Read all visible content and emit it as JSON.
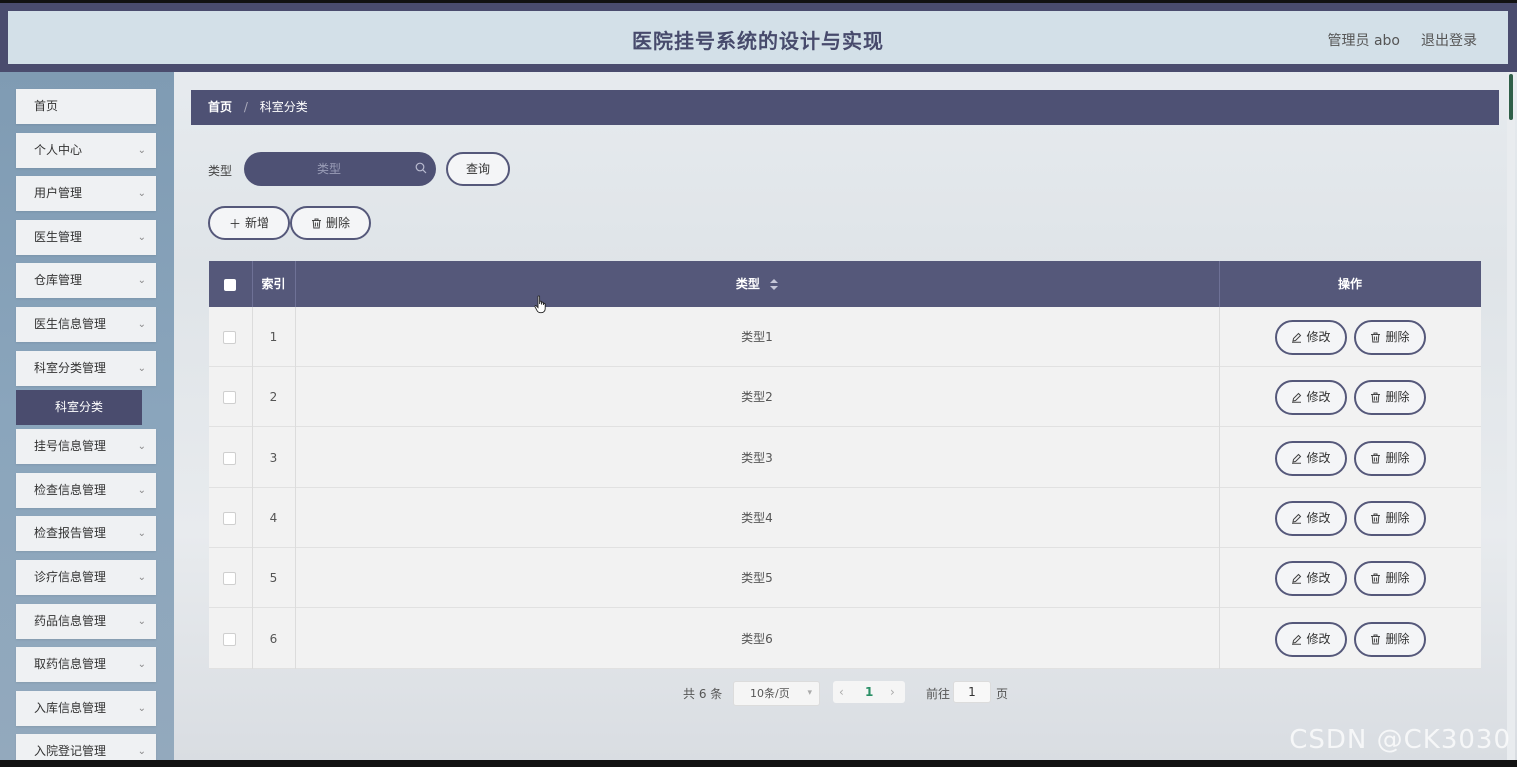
{
  "header": {
    "title": "医院挂号系统的设计与实现",
    "user": "管理员 abo",
    "logout": "退出登录"
  },
  "sidebar": {
    "items": [
      {
        "label": "首页",
        "has_children": false
      },
      {
        "label": "个人中心",
        "has_children": true
      },
      {
        "label": "用户管理",
        "has_children": true
      },
      {
        "label": "医生管理",
        "has_children": true
      },
      {
        "label": "仓库管理",
        "has_children": true
      },
      {
        "label": "医生信息管理",
        "has_children": true
      },
      {
        "label": "科室分类管理",
        "has_children": true,
        "expanded": true
      },
      {
        "label": "挂号信息管理",
        "has_children": true
      },
      {
        "label": "检查信息管理",
        "has_children": true
      },
      {
        "label": "检查报告管理",
        "has_children": true
      },
      {
        "label": "诊疗信息管理",
        "has_children": true
      },
      {
        "label": "药品信息管理",
        "has_children": true
      },
      {
        "label": "取药信息管理",
        "has_children": true
      },
      {
        "label": "入库信息管理",
        "has_children": true
      },
      {
        "label": "入院登记管理",
        "has_children": true
      }
    ],
    "active_sub": "科室分类",
    "chevron": "⌄"
  },
  "breadcrumb": {
    "home": "首页",
    "sep": "/",
    "current": "科室分类"
  },
  "search": {
    "label": "类型",
    "placeholder": "类型",
    "query_button": "查询"
  },
  "toolbar": {
    "add_label": "新增",
    "delete_label": "删除"
  },
  "table": {
    "columns": {
      "index": "索引",
      "type": "类型",
      "actions": "操作"
    },
    "rows": [
      {
        "index": "1",
        "type": "类型1"
      },
      {
        "index": "2",
        "type": "类型2"
      },
      {
        "index": "3",
        "type": "类型3"
      },
      {
        "index": "4",
        "type": "类型4"
      },
      {
        "index": "5",
        "type": "类型5"
      },
      {
        "index": "6",
        "type": "类型6"
      }
    ],
    "edit_label": "修改",
    "delete_label": "删除"
  },
  "pagination": {
    "total": "共 6 条",
    "page_size": "10条/页",
    "current_page": "1",
    "goto_label": "前往",
    "goto_value": "1",
    "page_suffix": "页",
    "prev": "‹",
    "next": "›"
  },
  "watermark": "CSDN @CK3030",
  "colors": {
    "primary": "#4e5174",
    "header_bg": "#d3e0e8",
    "sidebar_bg": "#8aa5bc",
    "accent_page": "#2a8f66"
  }
}
